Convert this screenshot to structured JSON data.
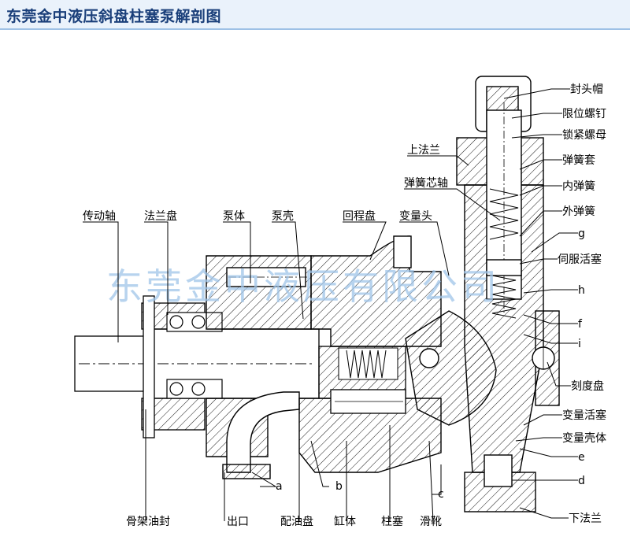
{
  "title": "东莞金中液压斜盘柱塞泵解剖图",
  "watermark": "东莞金中液压有限公司",
  "colors": {
    "title_bg": "#eaf2fb",
    "title_text": "#1a3f7a",
    "watermark": "#9fc4e8",
    "line": "#000000"
  },
  "labels": {
    "drive_shaft": "传动轴",
    "flange_plate": "法兰盘",
    "pump_body": "泵体",
    "pump_shell": "泵壳",
    "return_plate": "回程盘",
    "variable_head": "变量头",
    "upper_flange": "上法兰",
    "spring_core_shaft": "弹簧芯轴",
    "seal_cap": "封头帽",
    "limit_screw": "限位螺钉",
    "lock_nut": "锁紧螺母",
    "spring_sleeve": "弹簧套",
    "inner_spring": "内弹簧",
    "outer_spring": "外弹簧",
    "g": "g",
    "servo_piston": "伺服活塞",
    "h": "h",
    "f": "f",
    "i": "i",
    "dial": "刻度盘",
    "variable_piston": "变量活塞",
    "variable_housing": "变量壳体",
    "e": "e",
    "d": "d",
    "lower_flange": "下法兰",
    "skeleton_seal": "骨架油封",
    "outlet": "出口",
    "a": "a",
    "valve_plate": "配油盘",
    "b": "b",
    "cylinder": "缸体",
    "c": "c",
    "plunger": "柱塞",
    "slipper": "滑靴"
  }
}
